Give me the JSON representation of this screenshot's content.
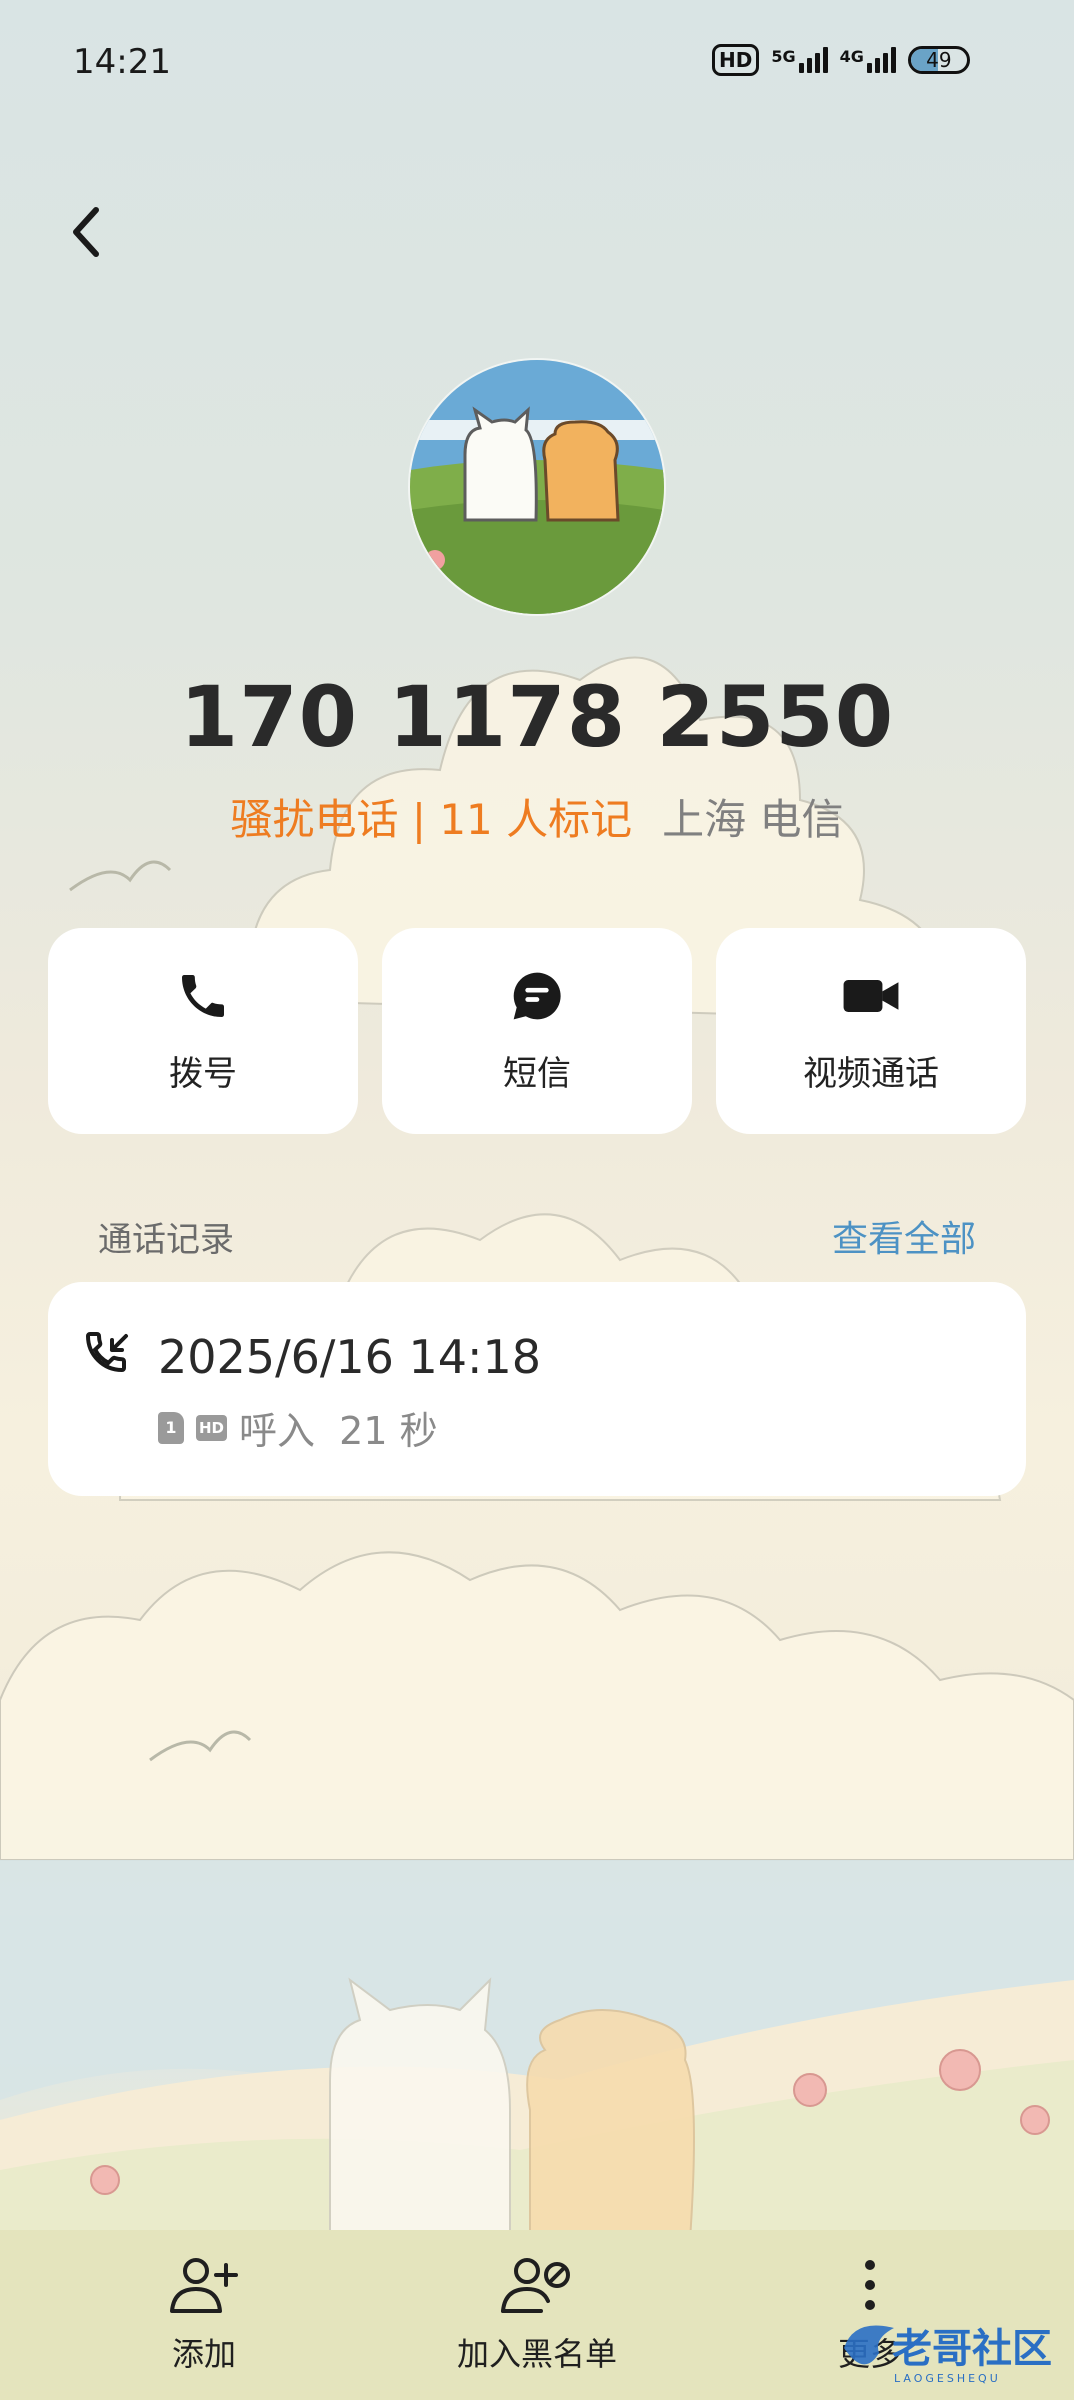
{
  "status_bar": {
    "time": "14:21",
    "hd": "HD",
    "sim1_network": "5G",
    "sim2_network": "4G",
    "battery": "49",
    "battery_level": 0.49
  },
  "contact": {
    "number": "170 1178 2550",
    "spam_label": "骚扰电话 | 11 人标记",
    "location": "上海 电信"
  },
  "actions": {
    "call": "拨号",
    "sms": "短信",
    "video": "视频通话"
  },
  "call_log": {
    "title": "通话记录",
    "see_all": "查看全部",
    "entries": [
      {
        "datetime": "2025/6/16 14:18",
        "sim": "1",
        "hd": "HD",
        "detail": "呼入  21 秒"
      }
    ]
  },
  "bottom_nav": {
    "add": "添加",
    "block": "加入黑名单",
    "more": "更多"
  },
  "watermark": "老哥社区",
  "colors": {
    "spam": "#ee7c21",
    "link": "#4d92c4",
    "bottom_bar": "#e4e4bd"
  }
}
